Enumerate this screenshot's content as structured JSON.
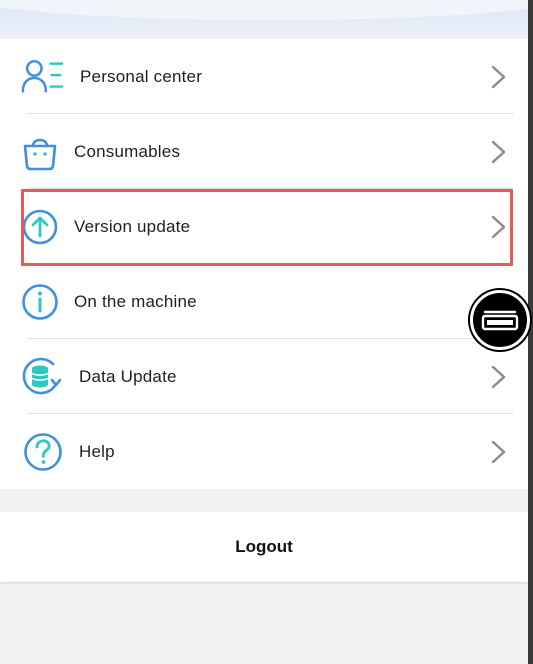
{
  "menu": {
    "items": [
      {
        "label": "Personal center",
        "icon": "person-list-icon"
      },
      {
        "label": "Consumables",
        "icon": "basket-icon"
      },
      {
        "label": "Version update",
        "icon": "arrow-up-circle-icon"
      },
      {
        "label": "On the machine",
        "icon": "info-circle-icon"
      },
      {
        "label": "Data Update",
        "icon": "database-refresh-icon"
      },
      {
        "label": "Help",
        "icon": "question-circle-icon"
      }
    ]
  },
  "logout": {
    "label": "Logout"
  },
  "colors": {
    "icon_blue": "#3f8fe0",
    "icon_cyan": "#2ec8c0",
    "highlight": "#e85a5a",
    "chevron": "#8a8a8a"
  },
  "floating_button": {
    "icon": "screenshot-tray-icon"
  }
}
